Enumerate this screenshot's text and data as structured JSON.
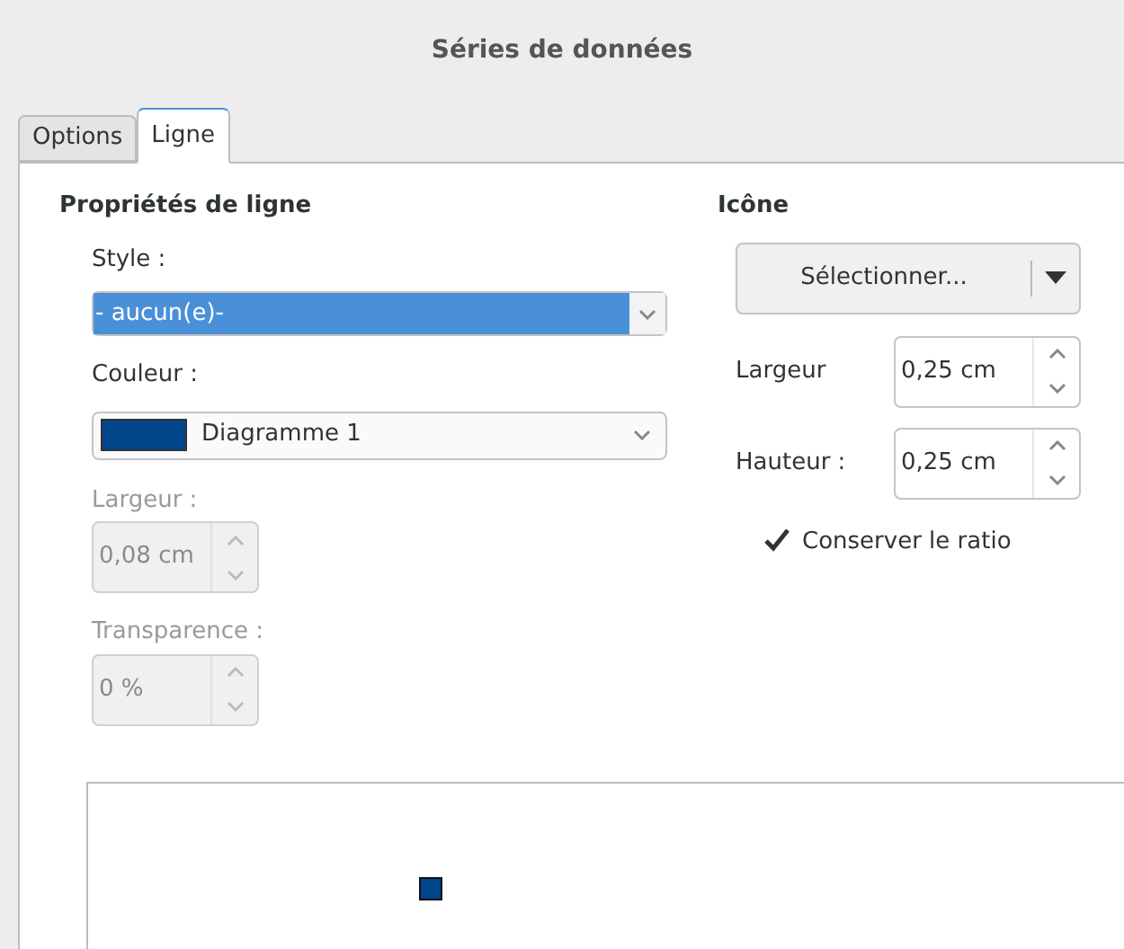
{
  "window": {
    "title": "Séries de données"
  },
  "tabs": [
    {
      "label": "Options",
      "selected": false
    },
    {
      "label": "Ligne",
      "selected": true
    }
  ],
  "line_properties": {
    "heading": "Propriétés de ligne",
    "style": {
      "label": "Style :",
      "value": "- aucun(e)-",
      "focused": true
    },
    "color": {
      "label": "Couleur :",
      "value": "Diagramme 1",
      "color": "#00458a"
    },
    "width": {
      "label": "Largeur :",
      "value": "0,08 cm",
      "disabled": true
    },
    "transparency": {
      "label": "Transparence :",
      "value": "0 %",
      "disabled": true
    }
  },
  "icon": {
    "heading": "Icône",
    "select_button": "Sélectionner...",
    "width": {
      "label": "Largeur",
      "value": "0,25 cm"
    },
    "height": {
      "label": "Hauteur :",
      "value": "0,25 cm"
    },
    "keep_ratio": {
      "label": "Conserver le ratio",
      "checked": true
    }
  }
}
